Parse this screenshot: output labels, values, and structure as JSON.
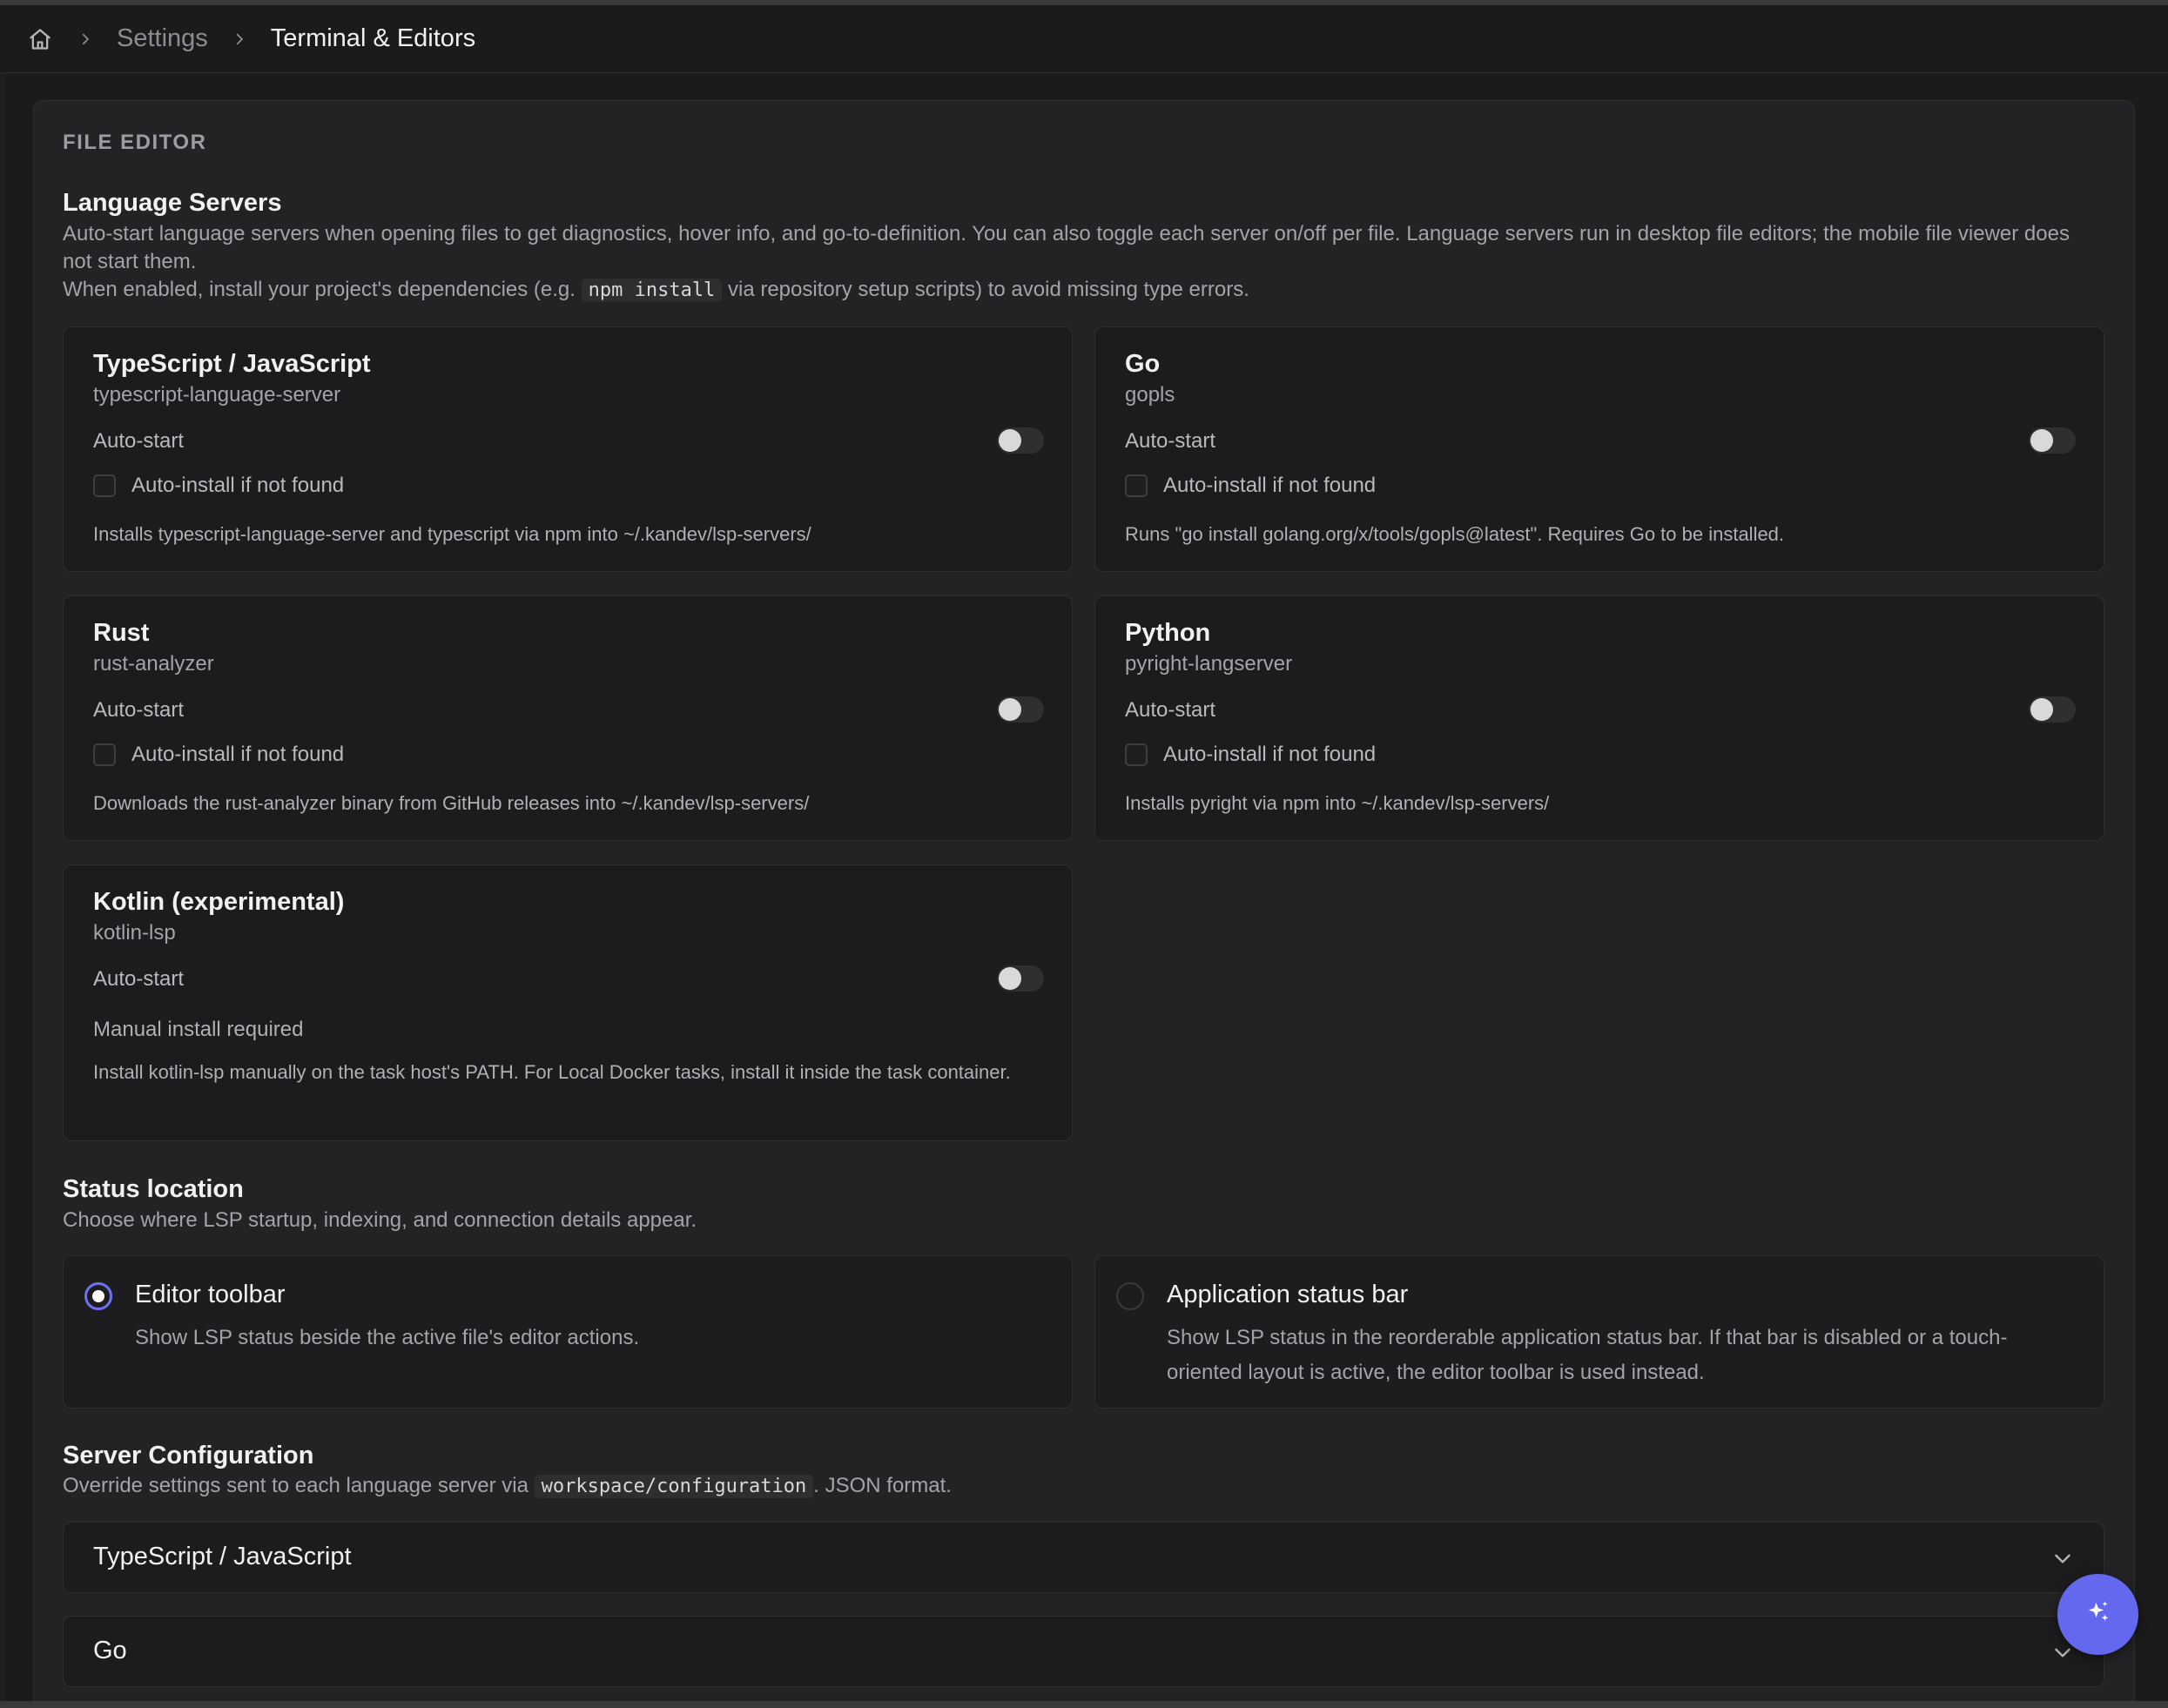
{
  "breadcrumb": {
    "home_icon": "home-icon",
    "separator_icon": "chevron-right-icon",
    "settings": "Settings",
    "current": "Terminal & Editors"
  },
  "section_label": "FILE EDITOR",
  "language_servers": {
    "title": "Language Servers",
    "description_1": "Auto-start language servers when opening files to get diagnostics, hover info, and go-to-definition. You can also toggle each server on/off per file. Language servers run in desktop file editors; the mobile file viewer does not start them.",
    "description_2_before": "When enabled, install your project's dependencies (e.g. ",
    "description_2_code": "npm install",
    "description_2_after": " via repository setup scripts) to avoid missing type errors.",
    "auto_start_label": "Auto-start",
    "auto_install_label": "Auto-install if not found",
    "servers": [
      {
        "name": "TypeScript / JavaScript",
        "binary": "typescript-language-server",
        "auto_start": false,
        "auto_install": false,
        "note": "Installs typescript-language-server and typescript via npm into ~/.kandev/lsp-servers/"
      },
      {
        "name": "Go",
        "binary": "gopls",
        "auto_start": false,
        "auto_install": false,
        "note": "Runs \"go install golang.org/x/tools/gopls@latest\". Requires Go to be installed."
      },
      {
        "name": "Rust",
        "binary": "rust-analyzer",
        "auto_start": false,
        "auto_install": false,
        "note": "Downloads the rust-analyzer binary from GitHub releases into ~/.kandev/lsp-servers/"
      },
      {
        "name": "Python",
        "binary": "pyright-langserver",
        "auto_start": false,
        "auto_install": false,
        "note": "Installs pyright via npm into ~/.kandev/lsp-servers/"
      },
      {
        "name": "Kotlin (experimental)",
        "binary": "kotlin-lsp",
        "auto_start": false,
        "manual_label": "Manual install required",
        "note": "Install kotlin-lsp manually on the task host's PATH. For Local Docker tasks, install it inside the task container."
      }
    ]
  },
  "status_location": {
    "title": "Status location",
    "description": "Choose where LSP startup, indexing, and connection details appear.",
    "selected": "editor_toolbar",
    "options": [
      {
        "id": "editor_toolbar",
        "title": "Editor toolbar",
        "description": "Show LSP status beside the active file's editor actions."
      },
      {
        "id": "application_status_bar",
        "title": "Application status bar",
        "description": "Show LSP status in the reorderable application status bar. If that bar is disabled or a touch-oriented layout is active, the editor toolbar is used instead."
      }
    ]
  },
  "server_configuration": {
    "title": "Server Configuration",
    "description_before": "Override settings sent to each language server via ",
    "description_code": "workspace/configuration",
    "description_after": ". JSON format.",
    "items": [
      {
        "label": "TypeScript / JavaScript",
        "icon": "chevron-down-icon"
      },
      {
        "label": "Go",
        "icon": "chevron-down-icon"
      }
    ]
  },
  "fab": {
    "icon": "sparkles-icon"
  },
  "colors": {
    "background": "#1b1b1c",
    "panel": "#232325",
    "card": "#1c1c1e",
    "accent": "#6368ee",
    "text_primary": "#f1f1f3",
    "text_secondary": "#a3a3a9"
  }
}
